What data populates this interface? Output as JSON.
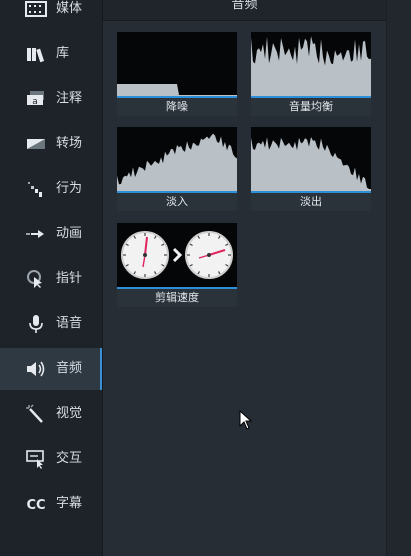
{
  "sidebar": {
    "items": [
      {
        "label": "媒体",
        "icon": "film-strip-icon"
      },
      {
        "label": "库",
        "icon": "library-books-icon"
      },
      {
        "label": "注释",
        "icon": "annotation-callout-icon"
      },
      {
        "label": "转场",
        "icon": "transition-icon"
      },
      {
        "label": "行为",
        "icon": "behavior-dots-icon"
      },
      {
        "label": "动画",
        "icon": "animation-arrow-icon"
      },
      {
        "label": "指针",
        "icon": "cursor-pointer-icon"
      },
      {
        "label": "语音",
        "icon": "microphone-icon"
      },
      {
        "label": "音频",
        "icon": "speaker-icon"
      },
      {
        "label": "视觉",
        "icon": "magic-wand-icon"
      },
      {
        "label": "交互",
        "icon": "interactive-cursor-icon"
      },
      {
        "label": "字幕",
        "icon": "cc-caption-icon"
      }
    ],
    "active_index": 8
  },
  "main": {
    "title": "音频",
    "effects": [
      {
        "label": "降噪",
        "icon": "noise-removal-waveform-icon"
      },
      {
        "label": "音量均衡",
        "icon": "volume-leveling-waveform-icon"
      },
      {
        "label": "淡入",
        "icon": "fade-in-waveform-icon"
      },
      {
        "label": "淡出",
        "icon": "fade-out-waveform-icon"
      },
      {
        "label": "剪辑速度",
        "icon": "clip-speed-clocks-icon"
      }
    ]
  },
  "colors": {
    "accent": "#2d8fd8",
    "sidebar_bg": "#1d2329",
    "panel_bg": "#262d34",
    "waveform": "#b9c0c6",
    "clock_hand": "#e0245e"
  }
}
